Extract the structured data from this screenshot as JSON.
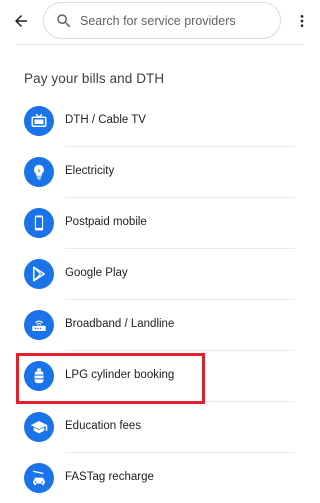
{
  "search": {
    "placeholder": "Search for service providers"
  },
  "section": {
    "title": "Pay your bills and DTH"
  },
  "items": [
    {
      "label": "DTH / Cable TV",
      "icon": "tv-icon"
    },
    {
      "label": "Electricity",
      "icon": "lightbulb-icon"
    },
    {
      "label": "Postpaid mobile",
      "icon": "phone-icon"
    },
    {
      "label": "Google Play",
      "icon": "google-play-icon"
    },
    {
      "label": "Broadband / Landline",
      "icon": "router-icon"
    },
    {
      "label": "LPG cylinder booking",
      "icon": "gas-cylinder-icon"
    },
    {
      "label": "Education fees",
      "icon": "graduation-cap-icon"
    },
    {
      "label": "FASTag recharge",
      "icon": "car-icon"
    }
  ],
  "colors": {
    "accent": "#1a73e8",
    "highlight": "#e0202b"
  }
}
